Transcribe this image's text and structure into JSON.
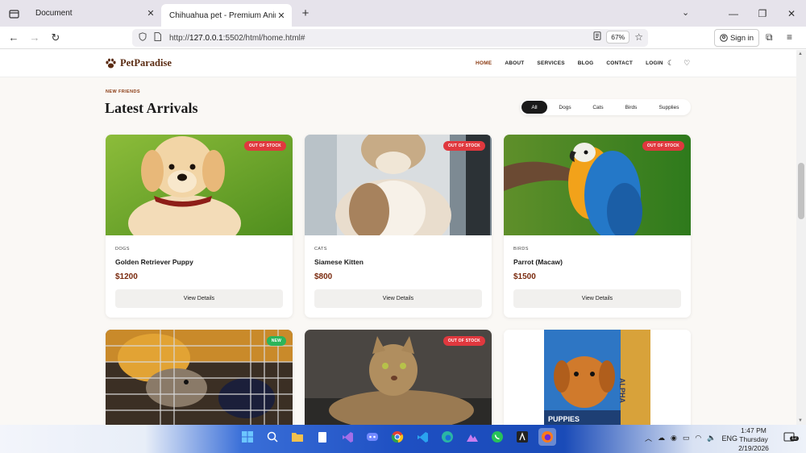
{
  "browser": {
    "tabs": [
      {
        "title": "Document",
        "active": false
      },
      {
        "title": "Chihuahua pet - Premium Animal St",
        "active": true
      }
    ],
    "url_host": "127.0.0.1",
    "url_rest": ":5502/html/home.html#",
    "url_prefix": "http://",
    "zoom": "67%",
    "signin_label": "Sign in"
  },
  "site": {
    "logo_text": "PetParadise",
    "menu": [
      "HOME",
      "ABOUT",
      "SERVICES",
      "BLOG",
      "CONTACT",
      "LOGIN"
    ],
    "active_menu": "HOME"
  },
  "section": {
    "eyebrow": "NEW FRIENDS",
    "title": "Latest Arrivals",
    "filters": [
      "All",
      "Dogs",
      "Cats",
      "Birds",
      "Supplies"
    ],
    "active_filter": "All"
  },
  "products": [
    {
      "category": "DOGS",
      "name": "Golden Retriever Puppy",
      "price": "$1200",
      "badge": "OUT OF STOCK",
      "button": "View Details"
    },
    {
      "category": "CATS",
      "name": "Siamese Kitten",
      "price": "$800",
      "badge": "OUT OF STOCK",
      "button": "View Details"
    },
    {
      "category": "BIRDS",
      "name": "Parrot (Macaw)",
      "price": "$1500",
      "badge": "OUT OF STOCK",
      "button": "View Details"
    },
    {
      "badge": "NEW"
    },
    {
      "badge": "OUT OF STOCK"
    },
    {
      "package_text": "PUPPIES",
      "package_brand": "ALPHA"
    }
  ],
  "taskbar": {
    "lang": "ENG",
    "time": "1:47 PM",
    "day": "Thursday",
    "date": "2/19/2026",
    "notifications": "12"
  },
  "colors": {
    "brand": "#5a2b12",
    "accent": "#8a3a12",
    "badge_oos": "#e0383e",
    "badge_new": "#2bb55a"
  }
}
